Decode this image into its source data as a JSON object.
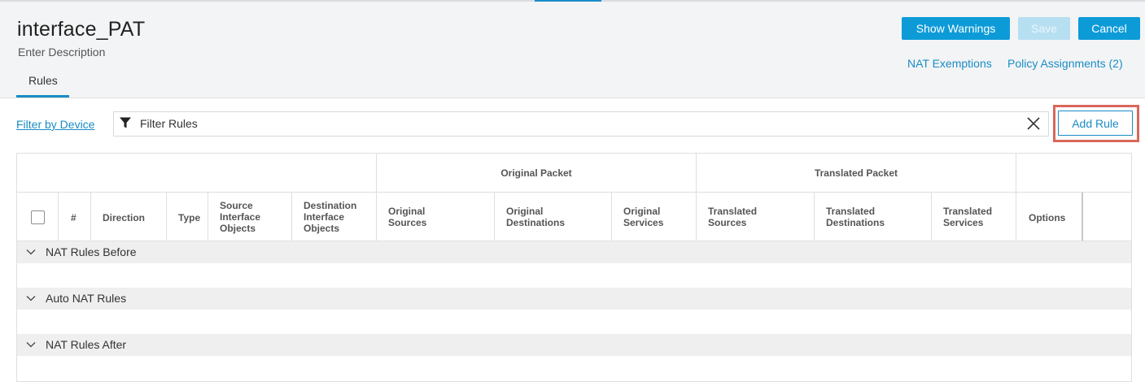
{
  "header": {
    "title": "interface_PAT",
    "description": "Enter Description",
    "tabs": [
      {
        "label": "Rules"
      }
    ]
  },
  "actions": {
    "show_warnings": "Show Warnings",
    "save": "Save",
    "cancel": "Cancel"
  },
  "links": {
    "nat_exemptions": "NAT Exemptions",
    "policy_assignments": "Policy Assignments (2)"
  },
  "toolbar": {
    "filter_by_device": "Filter by Device",
    "filter_placeholder": "Filter Rules",
    "add_rule": "Add Rule",
    "icons": [
      "filter-icon",
      "close-icon"
    ]
  },
  "table": {
    "groups": {
      "original": "Original Packet",
      "translated": "Translated Packet"
    },
    "columns": {
      "number": "#",
      "direction": "Direction",
      "type": "Type",
      "source_interface": [
        "Source",
        "Interface",
        "Objects"
      ],
      "destination_interface": [
        "Destination",
        "Interface",
        "Objects"
      ],
      "original_sources": [
        "Original",
        "Sources"
      ],
      "original_destinations": [
        "Original",
        "Destinations"
      ],
      "original_services": [
        "Original",
        "Services"
      ],
      "translated_sources": [
        "Translated",
        "Sources"
      ],
      "translated_destinations": [
        "Translated",
        "Destinations"
      ],
      "translated_services": [
        "Translated",
        "Services"
      ],
      "options": "Options"
    },
    "sections": [
      {
        "label": "NAT Rules Before"
      },
      {
        "label": "Auto NAT Rules"
      },
      {
        "label": "NAT Rules After"
      }
    ]
  },
  "colors": {
    "accent": "#0d9bd8",
    "link": "#1a8cc6",
    "highlight": "#d9675a"
  }
}
